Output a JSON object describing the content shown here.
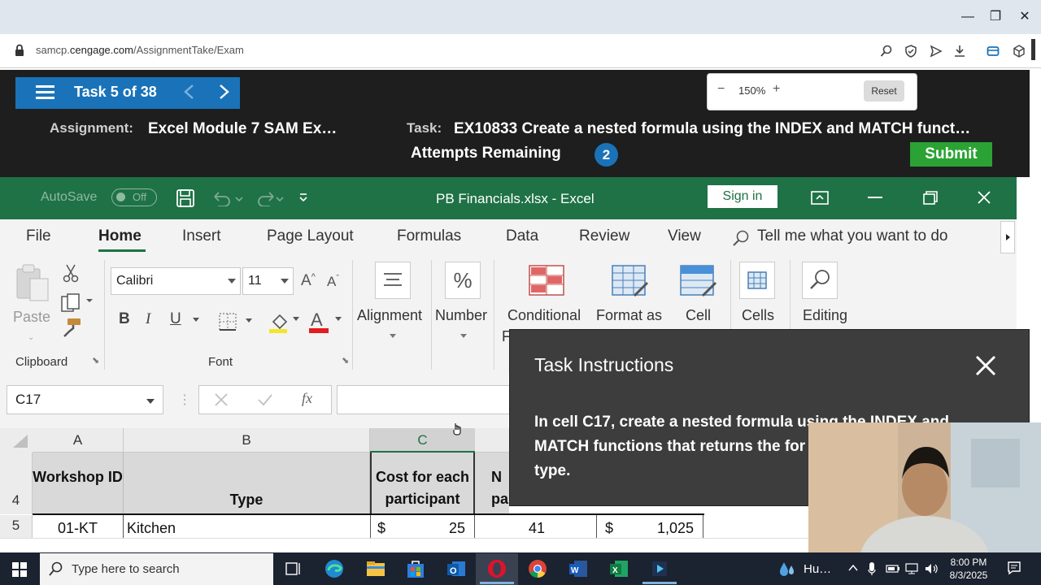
{
  "browser": {
    "url_prefix": "samcp.",
    "url_domain": "cengage.com",
    "url_path": "/AssignmentTake/Exam"
  },
  "sam": {
    "task_counter": "Task 5 of 38",
    "zoom": {
      "minus": "−",
      "value": "150%",
      "plus": "+",
      "reset": "Reset"
    },
    "assignment_label": "Assignment:",
    "assignment_value": "Excel Module 7 SAM Ex…",
    "task_label": "Task:",
    "task_value": "EX10833 Create a nested formula using the INDEX and MATCH funct…",
    "attempts_label": "Attempts Remaining",
    "attempts_count": "2",
    "submit": "Submit",
    "accent_color": "#1a73b8",
    "submit_color": "#2aa334"
  },
  "excel": {
    "autosave_label": "AutoSave",
    "autosave_state": "Off",
    "document_title": "PB Financials.xlsx - Excel",
    "sign_in": "Sign in",
    "brand_color": "#1f7246",
    "tabs": [
      "File",
      "Home",
      "Insert",
      "Page Layout",
      "Formulas",
      "Data",
      "Review",
      "View"
    ],
    "tell_me": "Tell me what you want to do",
    "ribbon": {
      "paste": "Paste",
      "clipboard_group": "Clipboard",
      "font_name": "Calibri",
      "font_size": "11",
      "bold": "B",
      "italic": "I",
      "underline": "U",
      "font_group": "Font",
      "alignment": "Alignment",
      "number": "Number",
      "conditional": "Conditional",
      "conditional_cut": "F",
      "format_as": "Format as",
      "cell": "Cell",
      "cells": "Cells",
      "editing": "Editing"
    },
    "name_box": "C17",
    "fx": "fx",
    "columns": [
      "A",
      "B",
      "C"
    ],
    "rows": [
      {
        "num": "4",
        "a": "Workshop ID",
        "b": "Type",
        "c": "Cost for each participant",
        "d": "N",
        "d2": "pa"
      },
      {
        "num": "5",
        "a": "01-KT",
        "b": "Kitchen",
        "c_cur": "$",
        "c_val": "25",
        "d": "41",
        "e_cur": "$",
        "e_val": "1,025"
      }
    ]
  },
  "instructions": {
    "title": "Task Instructions",
    "body": "In cell C17, create a nested formula using the INDEX and MATCH functions that returns the for the Bedroom workshop type."
  },
  "taskbar": {
    "search_placeholder": "Type here to search",
    "weather": "Hu…",
    "time": "8:00 PM",
    "date": "8/3/2025"
  }
}
